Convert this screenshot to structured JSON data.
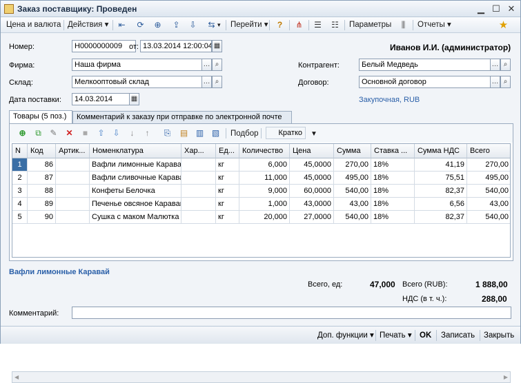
{
  "window": {
    "title": "Заказ поставщику: Проведен"
  },
  "toolbar": {
    "price_currency": "Цена и валюта",
    "actions": "Действия",
    "goto": "Перейти",
    "parameters": "Параметры",
    "reports": "Отчеты"
  },
  "header": {
    "number_label": "Номер:",
    "number_value": "Н0000000009",
    "date_label": "от:",
    "date_value": "13.03.2014 12:00:04",
    "user": "Иванов И.И. (администратор)",
    "firm_label": "Фирма:",
    "firm_value": "Наша фирма",
    "warehouse_label": "Склад:",
    "warehouse_value": "Мелкооптовый склад",
    "delivery_label": "Дата поставки:",
    "delivery_value": "14.03.2014",
    "counterparty_label": "Контрагент:",
    "counterparty_value": "Белый Медведь",
    "contract_label": "Договор:",
    "contract_value": "Основной договор",
    "price_type_link": "Закупочная, RUB"
  },
  "tabs": [
    {
      "label": "Товары (5 поз.)"
    },
    {
      "label": "Комментарий к заказу при отправке по электронной почте"
    }
  ],
  "grid_toolbar": {
    "selection": "Подбор",
    "view_mode": "Кратко"
  },
  "table": {
    "columns": [
      "N",
      "Код",
      "Артик...",
      "Номенклатура",
      "Хар...",
      "Ед...",
      "Количество",
      "Цена",
      "Сумма",
      "Ставка ...",
      "Сумма НДС",
      "Всего"
    ],
    "rows": [
      [
        "1",
        "86",
        "",
        "Вафли лимонные Каравай",
        "",
        "кг",
        "6,000",
        "45,0000",
        "270,00",
        "18%",
        "41,19",
        "270,00"
      ],
      [
        "2",
        "87",
        "",
        "Вафли сливочные Каравай",
        "",
        "кг",
        "11,000",
        "45,0000",
        "495,00",
        "18%",
        "75,51",
        "495,00"
      ],
      [
        "3",
        "88",
        "",
        "Конфеты Белочка",
        "",
        "кг",
        "9,000",
        "60,0000",
        "540,00",
        "18%",
        "82,37",
        "540,00"
      ],
      [
        "4",
        "89",
        "",
        "Печенье овсяное Каравай",
        "",
        "кг",
        "1,000",
        "43,0000",
        "43,00",
        "18%",
        "6,56",
        "43,00"
      ],
      [
        "5",
        "90",
        "",
        "Сушка с маком Малютка",
        "",
        "кг",
        "20,000",
        "27,0000",
        "540,00",
        "18%",
        "82,37",
        "540,00"
      ]
    ]
  },
  "summary": {
    "selected_item": "Вафли лимонные Каравай",
    "total_qty_label": "Всего, ед:",
    "total_qty": "47,000",
    "total_label": "Всего (RUB):",
    "total": "1 888,00",
    "vat_label": "НДС (в т. ч.):",
    "vat": "288,00",
    "comment_label": "Комментарий:",
    "comment_value": ""
  },
  "footer": {
    "extra": "Доп. функции",
    "print": "Печать",
    "ok": "OK",
    "save": "Записать",
    "close": "Закрыть"
  },
  "colors": {
    "link": "#2a5fa8",
    "selected_item": "#2a5fa8",
    "window_bg": "#f1f4f8"
  }
}
